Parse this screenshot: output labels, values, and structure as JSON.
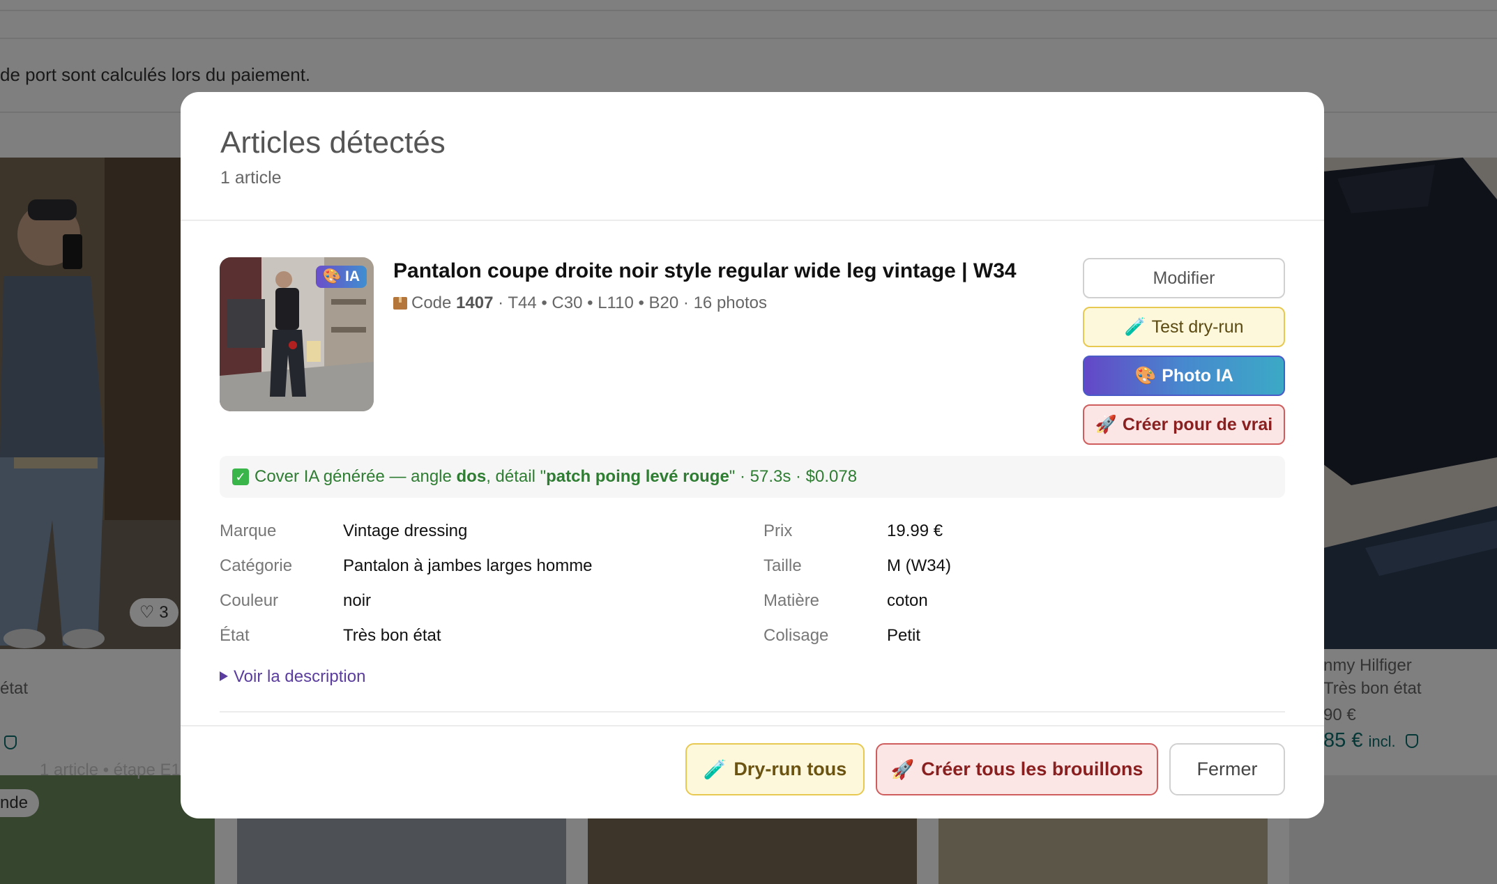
{
  "background": {
    "shipping_note": "de port sont calculés lors du paiement.",
    "left_card": {
      "state": "état",
      "favorites": "3"
    },
    "right_card": {
      "brand": "nmy Hilfiger",
      "state": "Très bon état",
      "price_small": "90 €",
      "price_incl": "85 €",
      "incl_label": "incl."
    },
    "bottom_badge": "nde"
  },
  "modal": {
    "title": "Articles détectés",
    "subtitle": "1 article",
    "item": {
      "ia_badge": "IA",
      "title": "Pantalon coupe droite noir style regular wide leg vintage | W34",
      "meta_prefix": "Code",
      "meta_code": "1407",
      "meta_rest": "· T44 • C30 • L110 • B20 · 16 photos"
    },
    "actions": {
      "modifier": "Modifier",
      "test_dryrun": "Test dry-run",
      "photo_ia": "Photo IA",
      "creer": "Créer pour de vrai"
    },
    "cover": {
      "text_1": "Cover IA générée — angle",
      "angle": "dos",
      "text_2": ", détail \"",
      "detail": "patch poing levé rouge",
      "text_3": "\" · 57.3s · $0.078"
    },
    "attributes_left": [
      {
        "label": "Marque",
        "value": "Vintage dressing"
      },
      {
        "label": "Catégorie",
        "value": "Pantalon à jambes larges homme"
      },
      {
        "label": "Couleur",
        "value": "noir"
      },
      {
        "label": "État",
        "value": "Très bon état"
      }
    ],
    "attributes_right": [
      {
        "label": "Prix",
        "value": "19.99 €"
      },
      {
        "label": "Taille",
        "value": "M (W34)"
      },
      {
        "label": "Matière",
        "value": "coton"
      },
      {
        "label": "Colisage",
        "value": "Petit"
      }
    ],
    "voir_description": "Voir la description",
    "footer": {
      "status": "1 article • étape E1",
      "dryrun_all": "Dry-run tous",
      "create_all": "Créer tous les brouillons",
      "close": "Fermer"
    }
  },
  "icons": {
    "thumb_badge": "palette-icon",
    "meta": "package-icon",
    "dryrun": "test-tube-icon",
    "photo": "palette-icon",
    "create": "rocket-icon",
    "cover": "check-mark-icon",
    "voir": "triangle-right-icon"
  },
  "colors": {
    "photo_gradient_start": "#6447c7",
    "photo_gradient_end": "#3ca9c6",
    "dryrun_bg": "#fdf8dc",
    "create_bg": "#fbe5e5",
    "cover_text": "#2e7d32",
    "link": "#5a3d9e"
  }
}
